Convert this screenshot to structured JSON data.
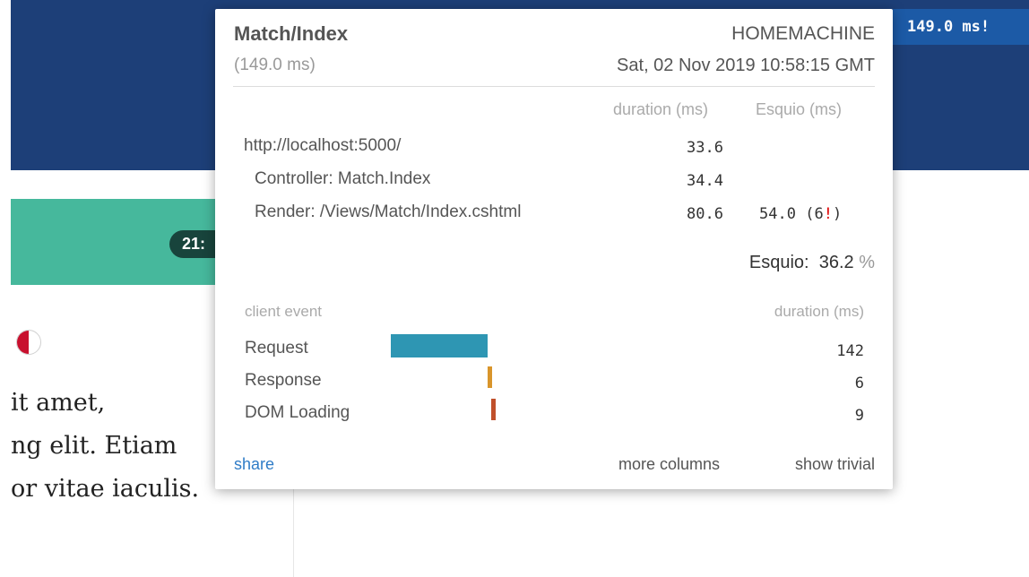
{
  "background": {
    "score_badge": "21:",
    "body_lines": [
      "it amet,",
      "ng elit. Etiam",
      "or vitae iaculis."
    ]
  },
  "timing_badge": "149.0 ms!",
  "popup": {
    "name": "Match/Index",
    "machine": "HOMEMACHINE",
    "duration": "(149.0 ms)",
    "date": "Sat, 02 Nov 2019 10:58:15 GMT",
    "col_duration": "duration (ms)",
    "col_esquio": "Esquio (ms)",
    "timings": [
      {
        "label": "http://localhost:5000/",
        "duration": "33.6",
        "esquio": ""
      },
      {
        "label": "Controller: Match.Index",
        "duration": "34.4",
        "esquio": ""
      },
      {
        "label": "Render: /Views/Match/Index.cshtml",
        "duration": "80.6",
        "esquio": "54.0",
        "esquio_count_prefix": "(6",
        "esquio_count_bang": "!",
        "esquio_count_suffix": ")"
      }
    ],
    "summary_label": "Esquio:",
    "summary_value": "36.2",
    "summary_pct": "%",
    "client_event_header": "client event",
    "client_duration_header": "duration (ms)",
    "client_events": [
      {
        "label": "Request",
        "duration": "142",
        "color": "#2e96b3"
      },
      {
        "label": "Response",
        "duration": "6",
        "color": "#d9952b"
      },
      {
        "label": "DOM Loading",
        "duration": "9",
        "color": "#c0502b"
      }
    ],
    "links": {
      "share": "share",
      "more_columns": "more columns",
      "show_trivial": "show trivial"
    }
  },
  "colors": {
    "navbar": "#1d3f78",
    "green_band": "#46b89c",
    "badge": "#1c5aa6",
    "link": "#2f7cc7",
    "bang": "#e00000"
  }
}
